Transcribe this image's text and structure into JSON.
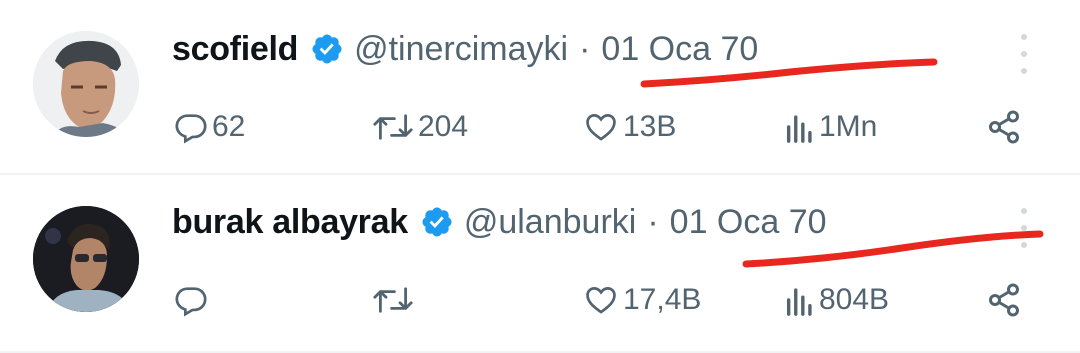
{
  "tweets": [
    {
      "name": "scofield",
      "handle": "@tinercimayki",
      "separator": "·",
      "date": "01 Oca 70",
      "replies": "62",
      "retweets": "204",
      "likes": "13B",
      "views": "1Mn"
    },
    {
      "name": "burak albayrak",
      "handle": "@ulanburki",
      "separator": "·",
      "date": "01 Oca 70",
      "replies": "",
      "retweets": "",
      "likes": "17,4B",
      "views": "804B"
    }
  ],
  "colors": {
    "verified_blue": "#1d9bf0",
    "muted_text": "#536471",
    "annotation_red": "#e8281e"
  },
  "icons": [
    "verified-badge-icon",
    "reply-icon",
    "retweet-icon",
    "like-icon",
    "views-icon",
    "share-icon",
    "more-icon"
  ]
}
